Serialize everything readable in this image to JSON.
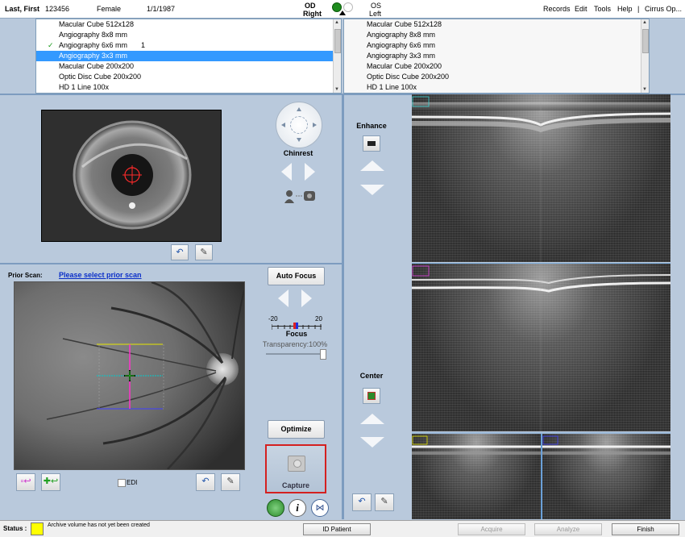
{
  "patient": {
    "name": "Last, First",
    "id": "123456",
    "sex": "Female",
    "dob": "1/1/1987"
  },
  "eye": {
    "od": "OD",
    "od_label": "Right",
    "os": "OS",
    "os_label": "Left",
    "od_color": "#1e8c1e",
    "active_color": "#1e8c1e"
  },
  "menu": {
    "records": "Records",
    "edit": "Edit",
    "tools": "Tools",
    "help": "Help",
    "sep": "|",
    "app": "Cirrus Op..."
  },
  "scan_list_left": {
    "items": [
      {
        "label": "Macular Cube 512x128",
        "check": "",
        "count": ""
      },
      {
        "label": "Angiography 8x8 mm",
        "check": "",
        "count": ""
      },
      {
        "label": "Angiography 6x6 mm",
        "check": "✓",
        "count": "1"
      },
      {
        "label": "Angiography 3x3 mm",
        "check": "",
        "count": ""
      },
      {
        "label": "Macular Cube 200x200",
        "check": "",
        "count": ""
      },
      {
        "label": "Optic Disc Cube 200x200",
        "check": "",
        "count": ""
      },
      {
        "label": "HD 1 Line 100x",
        "check": "",
        "count": ""
      }
    ],
    "selected_index": 3
  },
  "scan_list_right": {
    "items": [
      {
        "label": "Macular Cube 512x128"
      },
      {
        "label": "Angiography 8x8 mm"
      },
      {
        "label": "Angiography 6x6 mm"
      },
      {
        "label": "Angiography 3x3 mm"
      },
      {
        "label": "Macular Cube 200x200"
      },
      {
        "label": "Optic Disc Cube 200x200"
      },
      {
        "label": "HD 1 Line 100x"
      }
    ]
  },
  "iris": {
    "chinrest_label": "Chinrest"
  },
  "fundus": {
    "prior_scan_label": "Prior Scan:",
    "prior_scan_link": "Please select prior scan",
    "edi_label": "EDI"
  },
  "controls": {
    "auto_focus": "Auto Focus",
    "focus_min": "-20",
    "focus_max": "20",
    "focus_label": "Focus",
    "transparency_label": "Transparency:100%",
    "transparency_value": 1.0,
    "optimize": "Optimize",
    "capture": "Capture",
    "capture_highlight": "#d42020"
  },
  "oct": {
    "enhance_label": "Enhance",
    "center_label": "Center"
  },
  "status": {
    "label": "Status :",
    "swatch_color": "#ffff00",
    "message": "Archive volume has not yet been created",
    "id_patient": "ID Patient",
    "acquire": "Acquire",
    "analyze": "Analyze",
    "finish": "Finish"
  }
}
